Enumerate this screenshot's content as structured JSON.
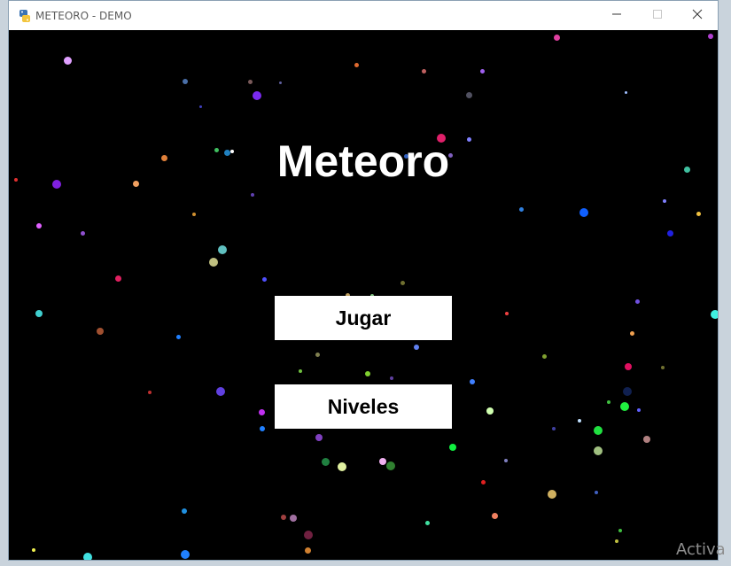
{
  "window": {
    "title": "METEORO - DEMO",
    "icon": "python-icon",
    "controls": [
      "minimize-icon",
      "maximize-icon",
      "close-icon"
    ]
  },
  "game": {
    "title": "Meteoro",
    "buttons": [
      {
        "label": "Jugar"
      },
      {
        "label": "Niveles"
      }
    ],
    "background_color": "#000000",
    "text_color": "#ffffff",
    "button_color": "#ffffff"
  },
  "watermark": "Activa"
}
